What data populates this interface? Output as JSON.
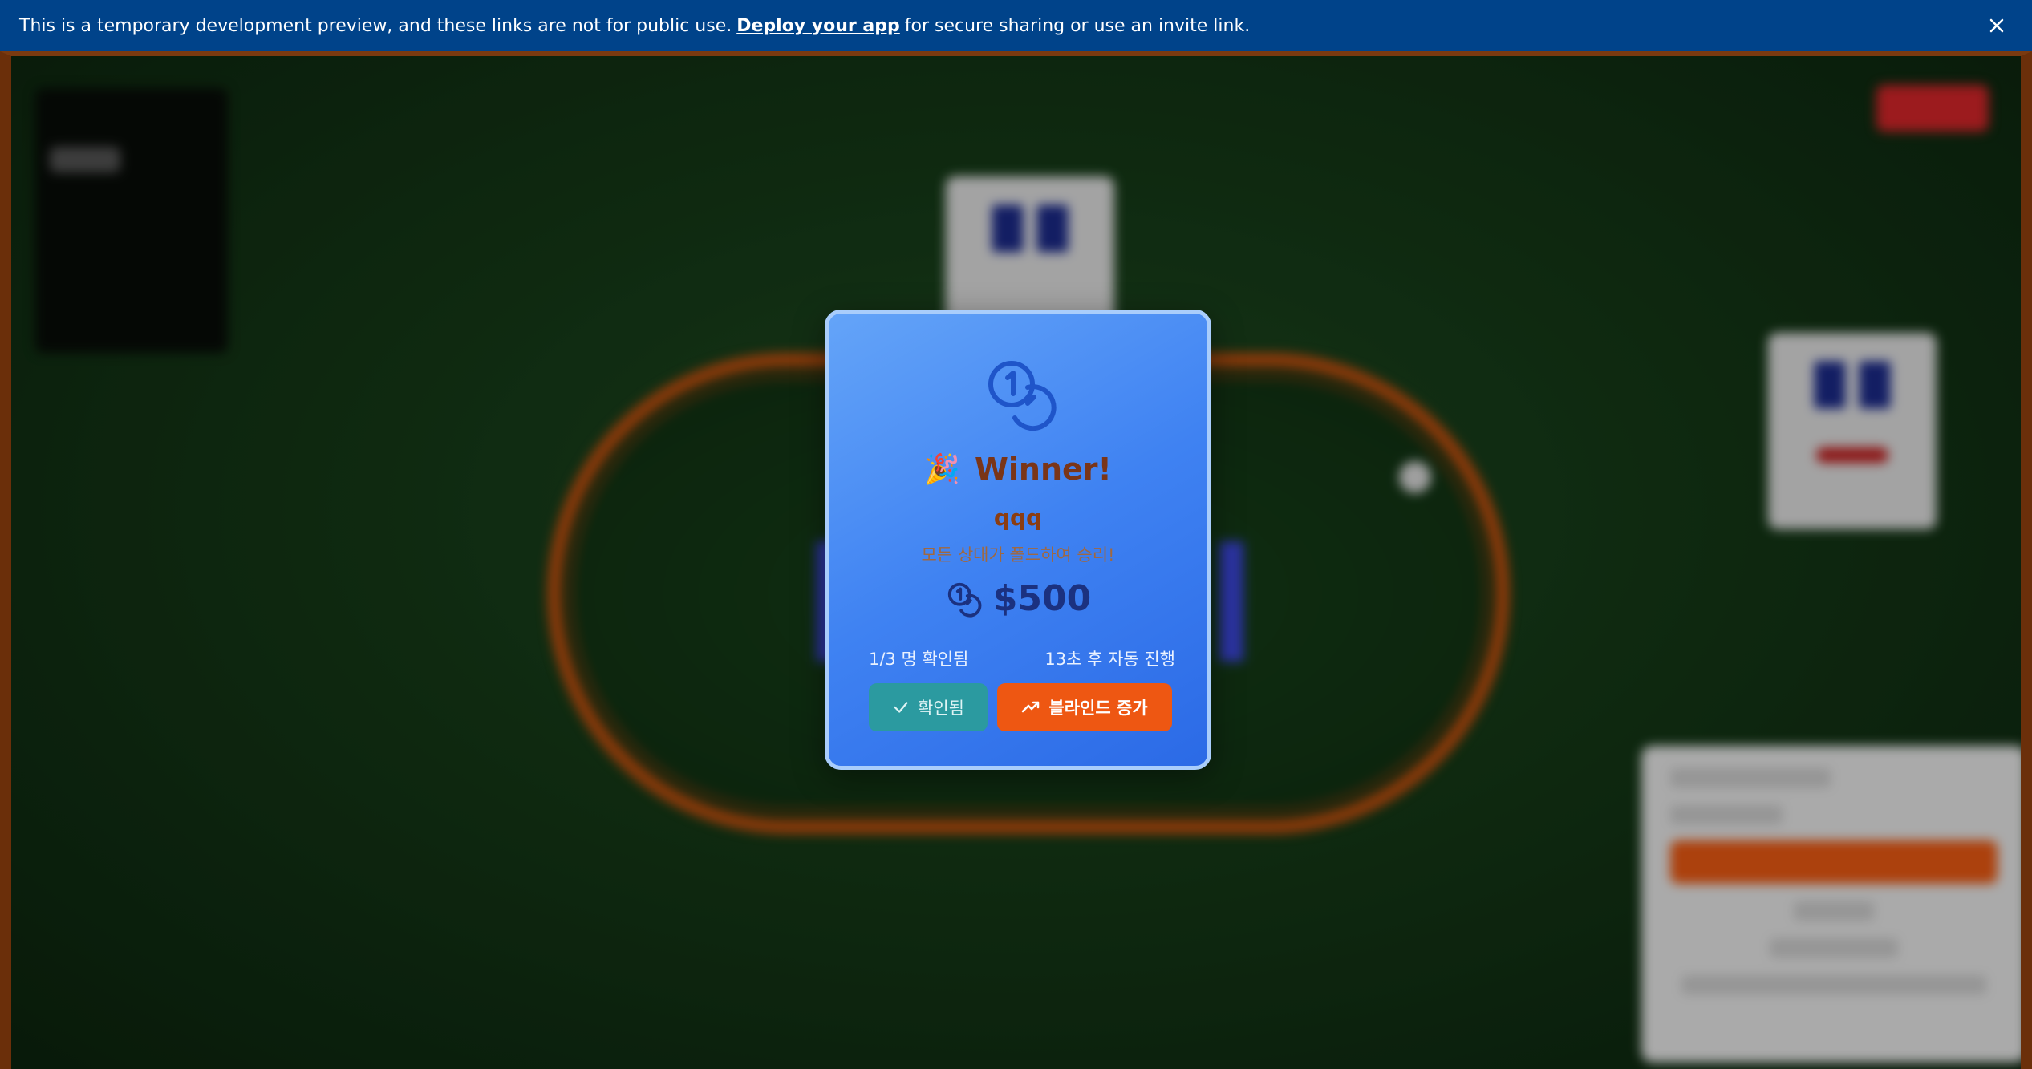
{
  "banner": {
    "text_before": "This is a temporary development preview, and these links are not for public use.",
    "link_text": "Deploy your app",
    "text_after": "for secure sharing or use an invite link."
  },
  "modal": {
    "title": "Winner!",
    "party_emoji": "🎉",
    "winner_name": "qqq",
    "reason": "모든 상대가 폴드하여 승리!",
    "amount": "$500",
    "confirmed_count": "1/3 명 확인됨",
    "countdown": "13초 후 자동 진행",
    "confirm_button": "확인됨",
    "blind_button": "블라인드 증가"
  },
  "colors": {
    "banner_bg": "#00438a",
    "modal_bg": "#3f82f2",
    "winner_text": "#7a3518",
    "amount_text": "#1b3180",
    "confirm_button_bg": "#2b9aa0",
    "blind_button_bg": "#ee5712"
  },
  "icons": [
    "close-icon",
    "coins-icon",
    "party-popper-icon",
    "check-icon",
    "trending-up-icon"
  ]
}
